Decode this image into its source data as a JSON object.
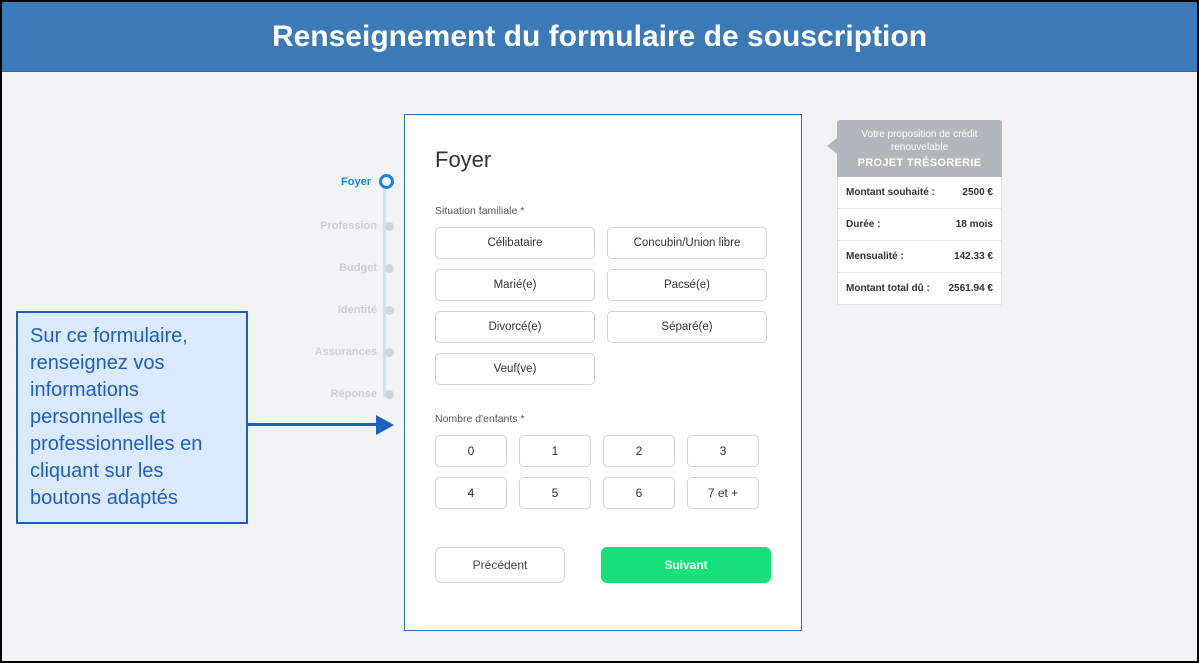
{
  "header": {
    "title": "Renseignement du formulaire de souscription"
  },
  "callout": {
    "text": "Sur ce formulaire, renseignez vos informations personnelles et professionnelles en cliquant sur les boutons adaptés"
  },
  "steps": [
    {
      "label": "Foyer",
      "active": true
    },
    {
      "label": "Profession",
      "active": false
    },
    {
      "label": "Budget",
      "active": false
    },
    {
      "label": "Identité",
      "active": false
    },
    {
      "label": "Assurances",
      "active": false
    },
    {
      "label": "Réponse",
      "active": false
    }
  ],
  "form": {
    "title": "Foyer",
    "situation_label": "Situation familiale *",
    "situation_options": [
      "Célibataire",
      "Concubin/Union libre",
      "Marié(e)",
      "Pacsé(e)",
      "Divorcé(e)",
      "Séparé(e)",
      "Veuf(ve)"
    ],
    "children_label": "Nombre d'enfants *",
    "children_options": [
      "0",
      "1",
      "2",
      "3",
      "4",
      "5",
      "6",
      "7 et +"
    ],
    "prev": "Précédent",
    "next": "Suivant"
  },
  "proposal": {
    "sub": "Votre proposition de crédit renouvelable",
    "title": "PROJET TRÉSORERIE",
    "rows": [
      {
        "k": "Montant souhaité :",
        "v": "2500 €"
      },
      {
        "k": "Durée :",
        "v": "18 mois"
      },
      {
        "k": "Mensualité :",
        "v": "142.33 €"
      },
      {
        "k": "Montant total dû :",
        "v": "2561.94 €"
      }
    ]
  }
}
